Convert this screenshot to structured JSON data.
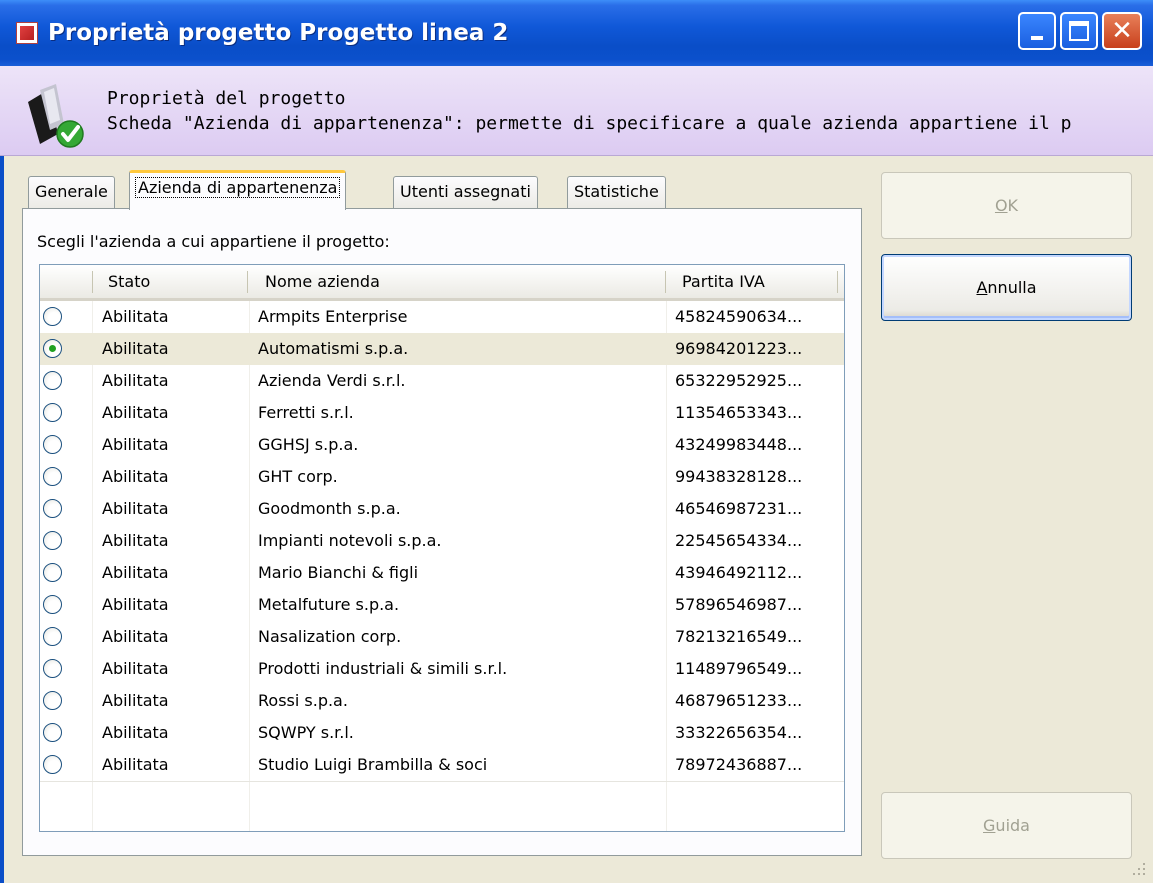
{
  "window": {
    "title": "Proprietà progetto Progetto linea 2"
  },
  "header": {
    "title": "Proprietà del progetto",
    "description": "Scheda \"Azienda di appartenenza\": permette di specificare a quale azienda appartiene il p"
  },
  "tabs": [
    {
      "label": "Generale",
      "active": false
    },
    {
      "label": "Azienda di appartenenza",
      "active": true
    },
    {
      "label": "Utenti assegnati",
      "active": false
    },
    {
      "label": "Statistiche",
      "active": false
    }
  ],
  "main": {
    "prompt": "Scegli l'azienda a cui appartiene il progetto:",
    "columns": [
      "",
      "Stato",
      "Nome azienda",
      "Partita IVA"
    ],
    "rows": [
      {
        "selected": false,
        "stato": "Abilitata",
        "nome": "Armpits Enterprise",
        "iva": "45824590634..."
      },
      {
        "selected": true,
        "stato": "Abilitata",
        "nome": "Automatismi s.p.a.",
        "iva": "96984201223..."
      },
      {
        "selected": false,
        "stato": "Abilitata",
        "nome": "Azienda Verdi s.r.l.",
        "iva": "65322952925..."
      },
      {
        "selected": false,
        "stato": "Abilitata",
        "nome": "Ferretti s.r.l.",
        "iva": "11354653343..."
      },
      {
        "selected": false,
        "stato": "Abilitata",
        "nome": "GGHSJ s.p.a.",
        "iva": "43249983448..."
      },
      {
        "selected": false,
        "stato": "Abilitata",
        "nome": "GHT corp.",
        "iva": "99438328128..."
      },
      {
        "selected": false,
        "stato": "Abilitata",
        "nome": "Goodmonth s.p.a.",
        "iva": "46546987231..."
      },
      {
        "selected": false,
        "stato": "Abilitata",
        "nome": "Impianti notevoli s.p.a.",
        "iva": "22545654334..."
      },
      {
        "selected": false,
        "stato": "Abilitata",
        "nome": "Mario Bianchi & figli",
        "iva": "43946492112..."
      },
      {
        "selected": false,
        "stato": "Abilitata",
        "nome": "Metalfuture s.p.a.",
        "iva": "57896546987..."
      },
      {
        "selected": false,
        "stato": "Abilitata",
        "nome": "Nasalization corp.",
        "iva": "78213216549..."
      },
      {
        "selected": false,
        "stato": "Abilitata",
        "nome": "Prodotti industriali & simili s.r.l.",
        "iva": "11489796549..."
      },
      {
        "selected": false,
        "stato": "Abilitata",
        "nome": "Rossi s.p.a.",
        "iva": "46879651233..."
      },
      {
        "selected": false,
        "stato": "Abilitata",
        "nome": "SQWPY s.r.l.",
        "iva": "33322656354..."
      },
      {
        "selected": false,
        "stato": "Abilitata",
        "nome": "Studio Luigi Brambilla & soci",
        "iva": "78972436887..."
      }
    ]
  },
  "buttons": {
    "ok": {
      "prefix": "",
      "mnemonic": "O",
      "rest": "K",
      "enabled": false
    },
    "annulla": {
      "prefix": "",
      "mnemonic": "A",
      "rest": "nnulla",
      "enabled": true
    },
    "guida": {
      "prefix": "",
      "mnemonic": "G",
      "rest": "uida",
      "enabled": false
    }
  },
  "colors": {
    "titlebar": "#0a4ec8",
    "header_band": "#dccbf2",
    "dialog_bg": "#ece9d8",
    "selected_radio": "#21a121"
  }
}
